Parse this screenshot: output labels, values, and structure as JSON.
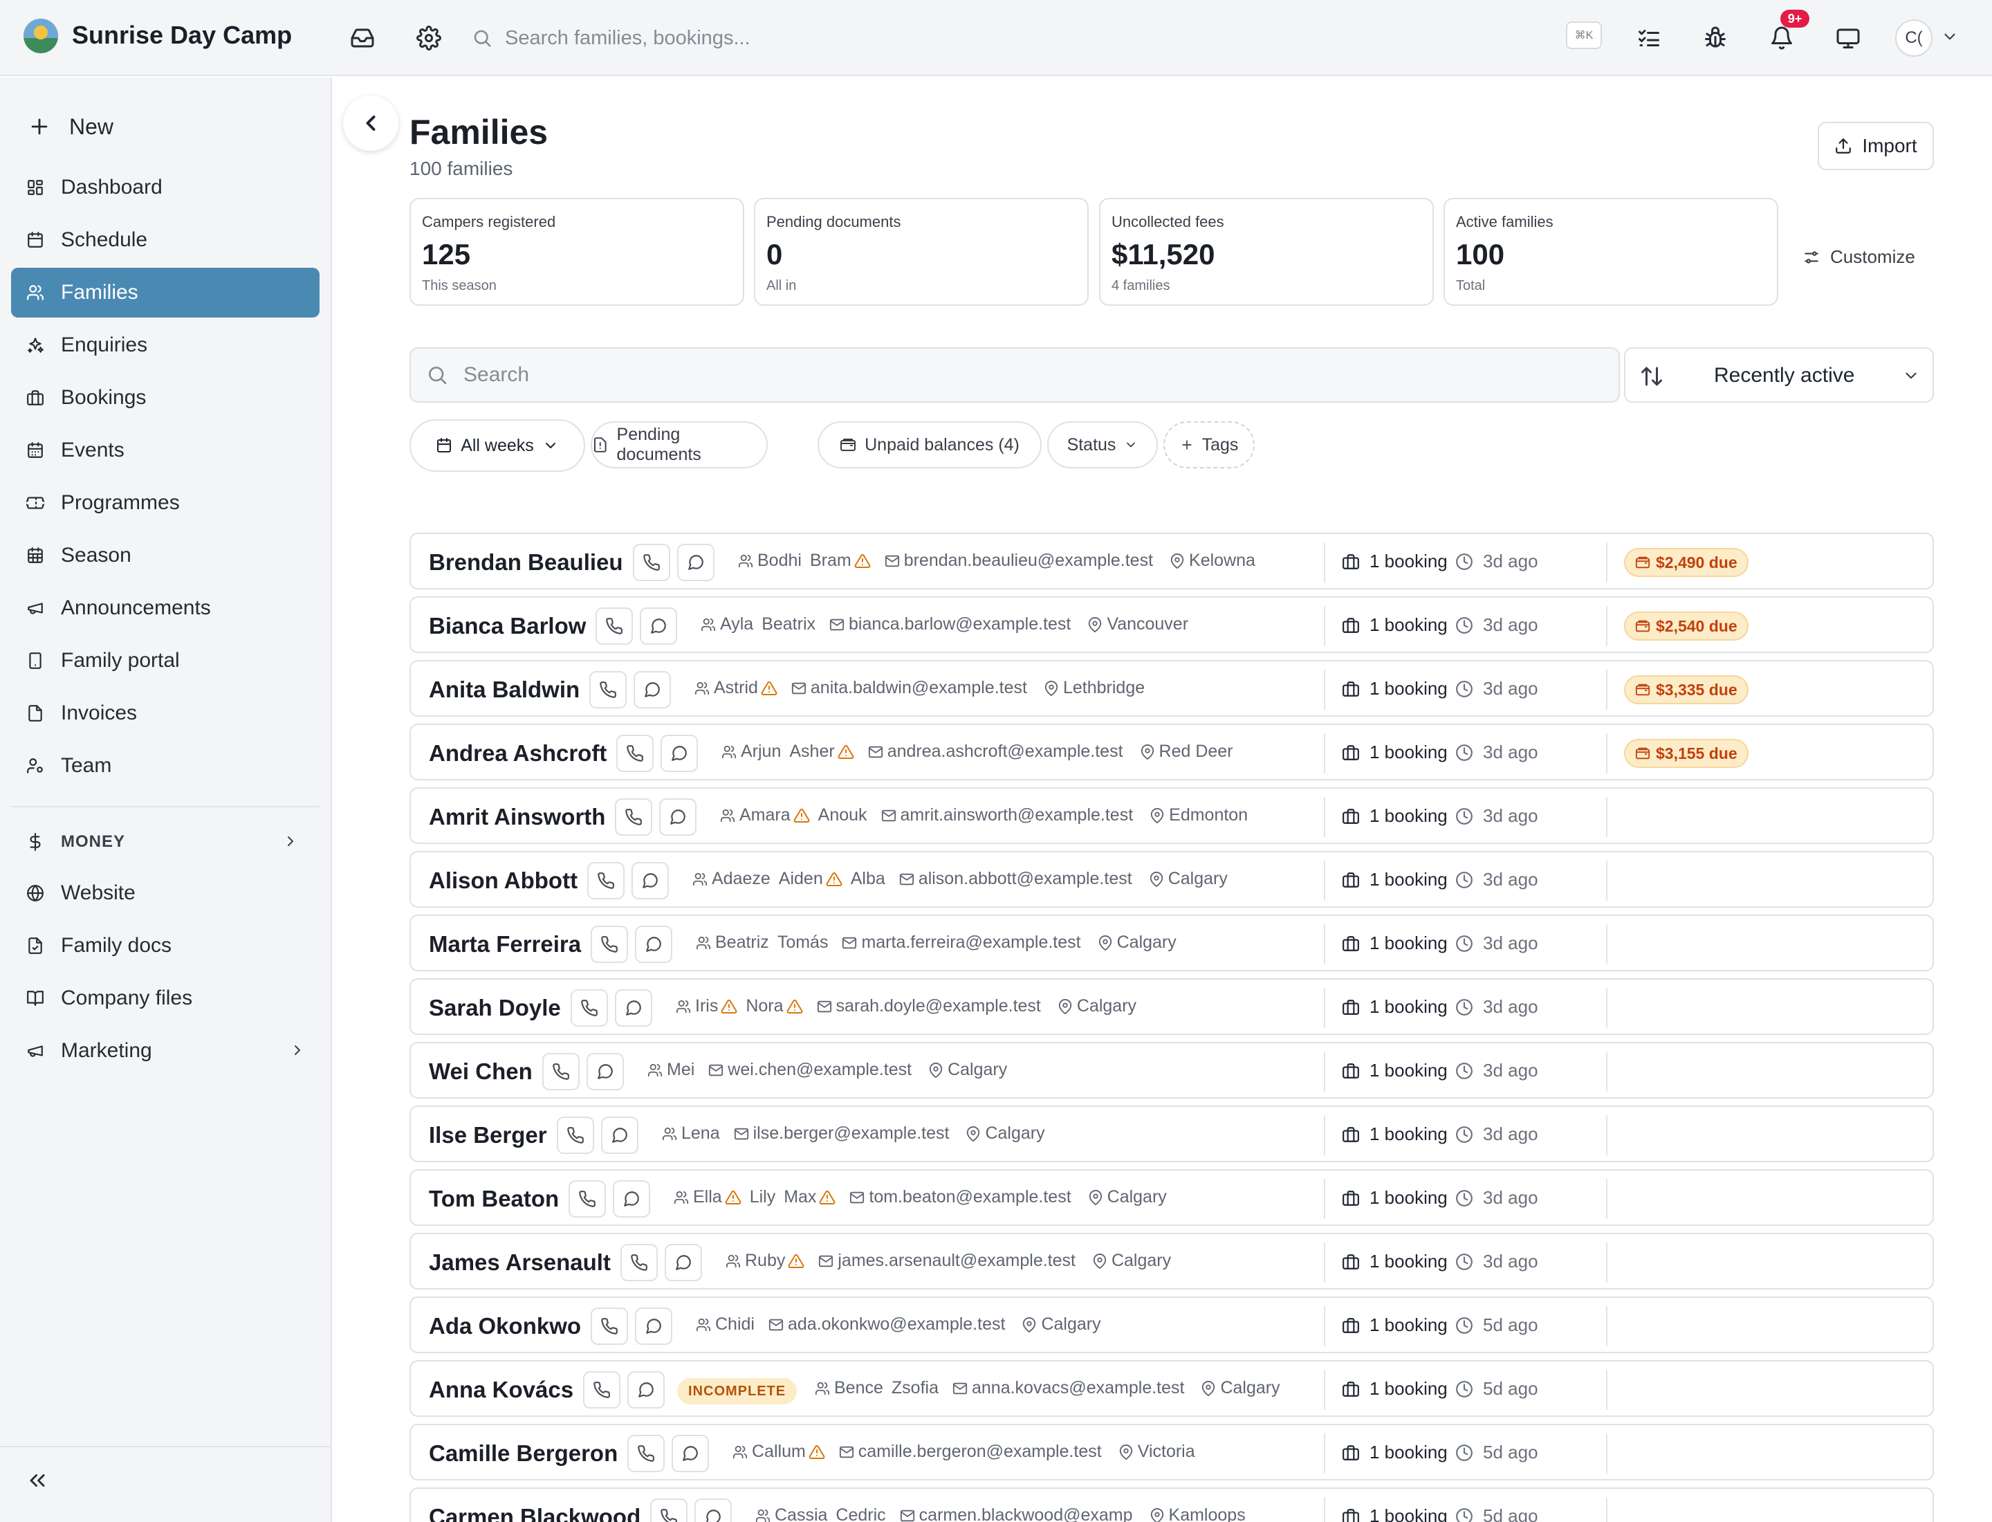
{
  "app": {
    "name": "Sunrise Day Camp"
  },
  "topbar": {
    "search_placeholder": "Search families, bookings...",
    "shortcut": "⌘K",
    "notification_badge": "9+",
    "avatar_initials": "C("
  },
  "sidebar": {
    "new_label": "New",
    "items": [
      {
        "label": "Dashboard",
        "icon": "dashboard-icon"
      },
      {
        "label": "Schedule",
        "icon": "calendar-icon"
      },
      {
        "label": "Families",
        "icon": "users-icon",
        "active": true
      },
      {
        "label": "Enquiries",
        "icon": "sparkle-icon"
      },
      {
        "label": "Bookings",
        "icon": "briefcase-icon"
      },
      {
        "label": "Events",
        "icon": "calendar-days-icon"
      },
      {
        "label": "Programmes",
        "icon": "ticket-icon"
      },
      {
        "label": "Season",
        "icon": "calendar-grid-icon"
      },
      {
        "label": "Announcements",
        "icon": "megaphone-icon"
      },
      {
        "label": "Family portal",
        "icon": "tablet-icon"
      },
      {
        "label": "Invoices",
        "icon": "file-icon"
      },
      {
        "label": "Team",
        "icon": "user-cog-icon"
      }
    ],
    "money_label": "MONEY",
    "bottom_items": [
      {
        "label": "Website",
        "icon": "globe-icon"
      },
      {
        "label": "Family docs",
        "icon": "file-check-icon"
      },
      {
        "label": "Company files",
        "icon": "book-open-icon"
      },
      {
        "label": "Marketing",
        "icon": "megaphone-icon"
      }
    ]
  },
  "page": {
    "title": "Families",
    "subtitle": "100 families",
    "import_label": "Import",
    "customize_label": "Customize"
  },
  "stats": [
    {
      "label": "Campers registered",
      "value": "125",
      "sub": "This season"
    },
    {
      "label": "Pending documents",
      "value": "0",
      "sub": "All in"
    },
    {
      "label": "Uncollected fees",
      "value": "$11,520",
      "sub": "4 families"
    },
    {
      "label": "Active families",
      "value": "100",
      "sub": "Total"
    }
  ],
  "list": {
    "search_placeholder": "Search",
    "sort_label": "Recently active",
    "filters": {
      "weeks": "All weeks",
      "pending_documents": "Pending documents",
      "unpaid_balances": "Unpaid balances (4)",
      "status": "Status",
      "tags": "Tags"
    }
  },
  "families": [
    {
      "name": "Brendan Beaulieu",
      "children": [
        {
          "name": "Bodhi",
          "warn": false
        },
        {
          "name": "Bram",
          "warn": true
        }
      ],
      "email": "brendan.beaulieu@example.test",
      "city": "Kelowna",
      "bookings": "1 booking",
      "last_active": "3d ago",
      "due": "$2,490 due"
    },
    {
      "name": "Bianca Barlow",
      "children": [
        {
          "name": "Ayla",
          "warn": false
        },
        {
          "name": "Beatrix",
          "warn": false
        }
      ],
      "email": "bianca.barlow@example.test",
      "city": "Vancouver",
      "bookings": "1 booking",
      "last_active": "3d ago",
      "due": "$2,540 due"
    },
    {
      "name": "Anita Baldwin",
      "children": [
        {
          "name": "Astrid",
          "warn": true
        }
      ],
      "email": "anita.baldwin@example.test",
      "city": "Lethbridge",
      "bookings": "1 booking",
      "last_active": "3d ago",
      "due": "$3,335 due"
    },
    {
      "name": "Andrea Ashcroft",
      "children": [
        {
          "name": "Arjun",
          "warn": false
        },
        {
          "name": "Asher",
          "warn": true
        }
      ],
      "email": "andrea.ashcroft@example.test",
      "city": "Red Deer",
      "bookings": "1 booking",
      "last_active": "3d ago",
      "due": "$3,155 due"
    },
    {
      "name": "Amrit Ainsworth",
      "children": [
        {
          "name": "Amara",
          "warn": true
        },
        {
          "name": "Anouk",
          "warn": false
        }
      ],
      "email": "amrit.ainsworth@example.test",
      "city": "Edmonton",
      "bookings": "1 booking",
      "last_active": "3d ago"
    },
    {
      "name": "Alison Abbott",
      "children": [
        {
          "name": "Adaeze",
          "warn": false
        },
        {
          "name": "Aiden",
          "warn": true
        },
        {
          "name": "Alba",
          "warn": false
        }
      ],
      "email": "alison.abbott@example.test",
      "city": "Calgary",
      "bookings": "1 booking",
      "last_active": "3d ago"
    },
    {
      "name": "Marta Ferreira",
      "children": [
        {
          "name": "Beatriz",
          "warn": false
        },
        {
          "name": "Tomás",
          "warn": false
        }
      ],
      "email": "marta.ferreira@example.test",
      "city": "Calgary",
      "bookings": "1 booking",
      "last_active": "3d ago"
    },
    {
      "name": "Sarah Doyle",
      "children": [
        {
          "name": "Iris",
          "warn": true
        },
        {
          "name": "Nora",
          "warn": true
        }
      ],
      "email": "sarah.doyle@example.test",
      "city": "Calgary",
      "bookings": "1 booking",
      "last_active": "3d ago"
    },
    {
      "name": "Wei Chen",
      "children": [
        {
          "name": "Mei",
          "warn": false
        }
      ],
      "email": "wei.chen@example.test",
      "city": "Calgary",
      "bookings": "1 booking",
      "last_active": "3d ago"
    },
    {
      "name": "Ilse Berger",
      "children": [
        {
          "name": "Lena",
          "warn": false
        }
      ],
      "email": "ilse.berger@example.test",
      "city": "Calgary",
      "bookings": "1 booking",
      "last_active": "3d ago"
    },
    {
      "name": "Tom Beaton",
      "children": [
        {
          "name": "Ella",
          "warn": true
        },
        {
          "name": "Lily",
          "warn": false
        },
        {
          "name": "Max",
          "warn": true
        }
      ],
      "email": "tom.beaton@example.test",
      "city": "Calgary",
      "bookings": "1 booking",
      "last_active": "3d ago"
    },
    {
      "name": "James Arsenault",
      "children": [
        {
          "name": "Ruby",
          "warn": true
        }
      ],
      "email": "james.arsenault@example.test",
      "city": "Calgary",
      "bookings": "1 booking",
      "last_active": "3d ago"
    },
    {
      "name": "Ada Okonkwo",
      "children": [
        {
          "name": "Chidi",
          "warn": false
        }
      ],
      "email": "ada.okonkwo@example.test",
      "city": "Calgary",
      "bookings": "1 booking",
      "last_active": "5d ago"
    },
    {
      "name": "Anna Kovács",
      "status": "INCOMPLETE",
      "children": [
        {
          "name": "Bence",
          "warn": false
        },
        {
          "name": "Zsofia",
          "warn": false
        }
      ],
      "email": "anna.kovacs@example.test",
      "city": "Calgary",
      "bookings": "1 booking",
      "last_active": "5d ago"
    },
    {
      "name": "Camille Bergeron",
      "children": [
        {
          "name": "Callum",
          "warn": true
        }
      ],
      "email": "camille.bergeron@example.test",
      "city": "Victoria",
      "bookings": "1 booking",
      "last_active": "5d ago"
    },
    {
      "name": "Carmen Blackwood",
      "children": [
        {
          "name": "Cassia",
          "warn": false
        },
        {
          "name": "Cedric",
          "warn": false
        }
      ],
      "email": "carmen.blackwood@examp",
      "city": "Kamloops",
      "bookings": "1 booking",
      "last_active": "5d ago"
    }
  ]
}
